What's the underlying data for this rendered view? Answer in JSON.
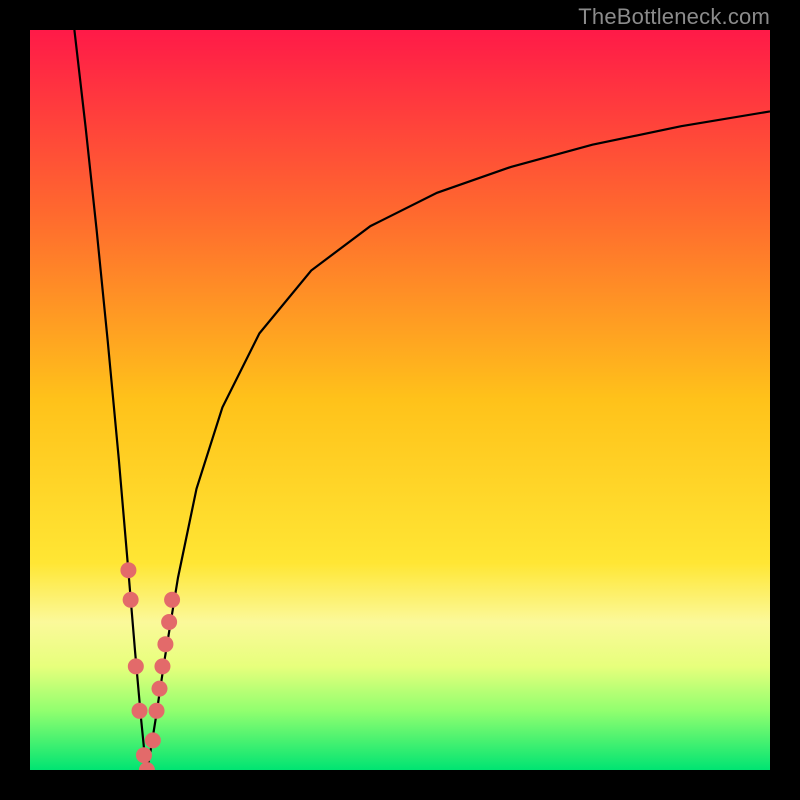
{
  "watermark": "TheBottleneck.com",
  "chart_data": {
    "type": "line",
    "title": "",
    "xlabel": "",
    "ylabel": "",
    "xlim": [
      0,
      100
    ],
    "ylim": [
      0,
      100
    ],
    "background_gradient": {
      "stops": [
        {
          "offset": 0.0,
          "color": "#ff1a48"
        },
        {
          "offset": 0.25,
          "color": "#ff6a2e"
        },
        {
          "offset": 0.5,
          "color": "#ffc21a"
        },
        {
          "offset": 0.72,
          "color": "#ffe634"
        },
        {
          "offset": 0.8,
          "color": "#fbf99a"
        },
        {
          "offset": 0.86,
          "color": "#e7ff7c"
        },
        {
          "offset": 0.92,
          "color": "#91ff6f"
        },
        {
          "offset": 1.0,
          "color": "#00e472"
        }
      ]
    },
    "series": [
      {
        "name": "left-branch",
        "x": [
          6.0,
          7.5,
          9.0,
          10.5,
          12.0,
          13.2,
          14.2,
          15.0,
          15.5,
          15.8
        ],
        "y": [
          100,
          87,
          73,
          58,
          42,
          28,
          16,
          7,
          2,
          0
        ]
      },
      {
        "name": "right-branch",
        "x": [
          15.8,
          16.2,
          17.0,
          18.2,
          20.0,
          22.5,
          26.0,
          31.0,
          38.0,
          46.0,
          55.0,
          65.0,
          76.0,
          88.0,
          100.0
        ],
        "y": [
          0,
          2,
          7,
          15,
          26,
          38,
          49,
          59,
          67.5,
          73.5,
          78,
          81.5,
          84.5,
          87,
          89
        ]
      }
    ],
    "scatter": {
      "name": "highlight-points",
      "color": "#e36a6a",
      "radius_px": 8,
      "points": [
        {
          "x": 13.3,
          "y": 27
        },
        {
          "x": 13.6,
          "y": 23
        },
        {
          "x": 14.3,
          "y": 14
        },
        {
          "x": 14.8,
          "y": 8
        },
        {
          "x": 15.4,
          "y": 2
        },
        {
          "x": 15.8,
          "y": 0
        },
        {
          "x": 16.6,
          "y": 4
        },
        {
          "x": 17.1,
          "y": 8
        },
        {
          "x": 17.5,
          "y": 11
        },
        {
          "x": 17.9,
          "y": 14
        },
        {
          "x": 18.3,
          "y": 17
        },
        {
          "x": 18.8,
          "y": 20
        },
        {
          "x": 19.2,
          "y": 23
        }
      ]
    }
  }
}
